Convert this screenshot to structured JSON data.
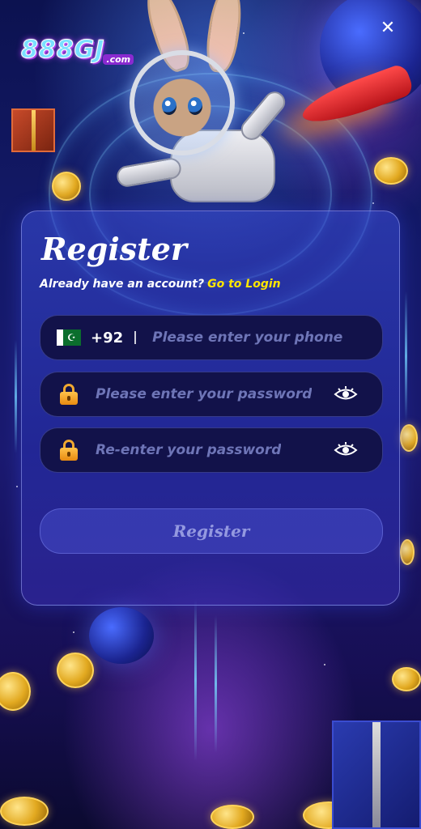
{
  "header": {
    "logo_main": "888GJ",
    "logo_suffix": ".com",
    "close_symbol": "✕"
  },
  "register": {
    "title": "Register",
    "subtitle": "Already have an account?",
    "login_link": "Go to Login",
    "phone": {
      "country_flag": "pakistan-flag-icon",
      "country_code": "+92",
      "placeholder": "Please enter your phone"
    },
    "password": {
      "placeholder": "Please enter your password"
    },
    "confirm_password": {
      "placeholder": "Re-enter your password"
    },
    "submit_label": "Register"
  },
  "colors": {
    "link": "#ffe600",
    "field_bg": "#12124a",
    "lock_icon": "#f0a830"
  }
}
